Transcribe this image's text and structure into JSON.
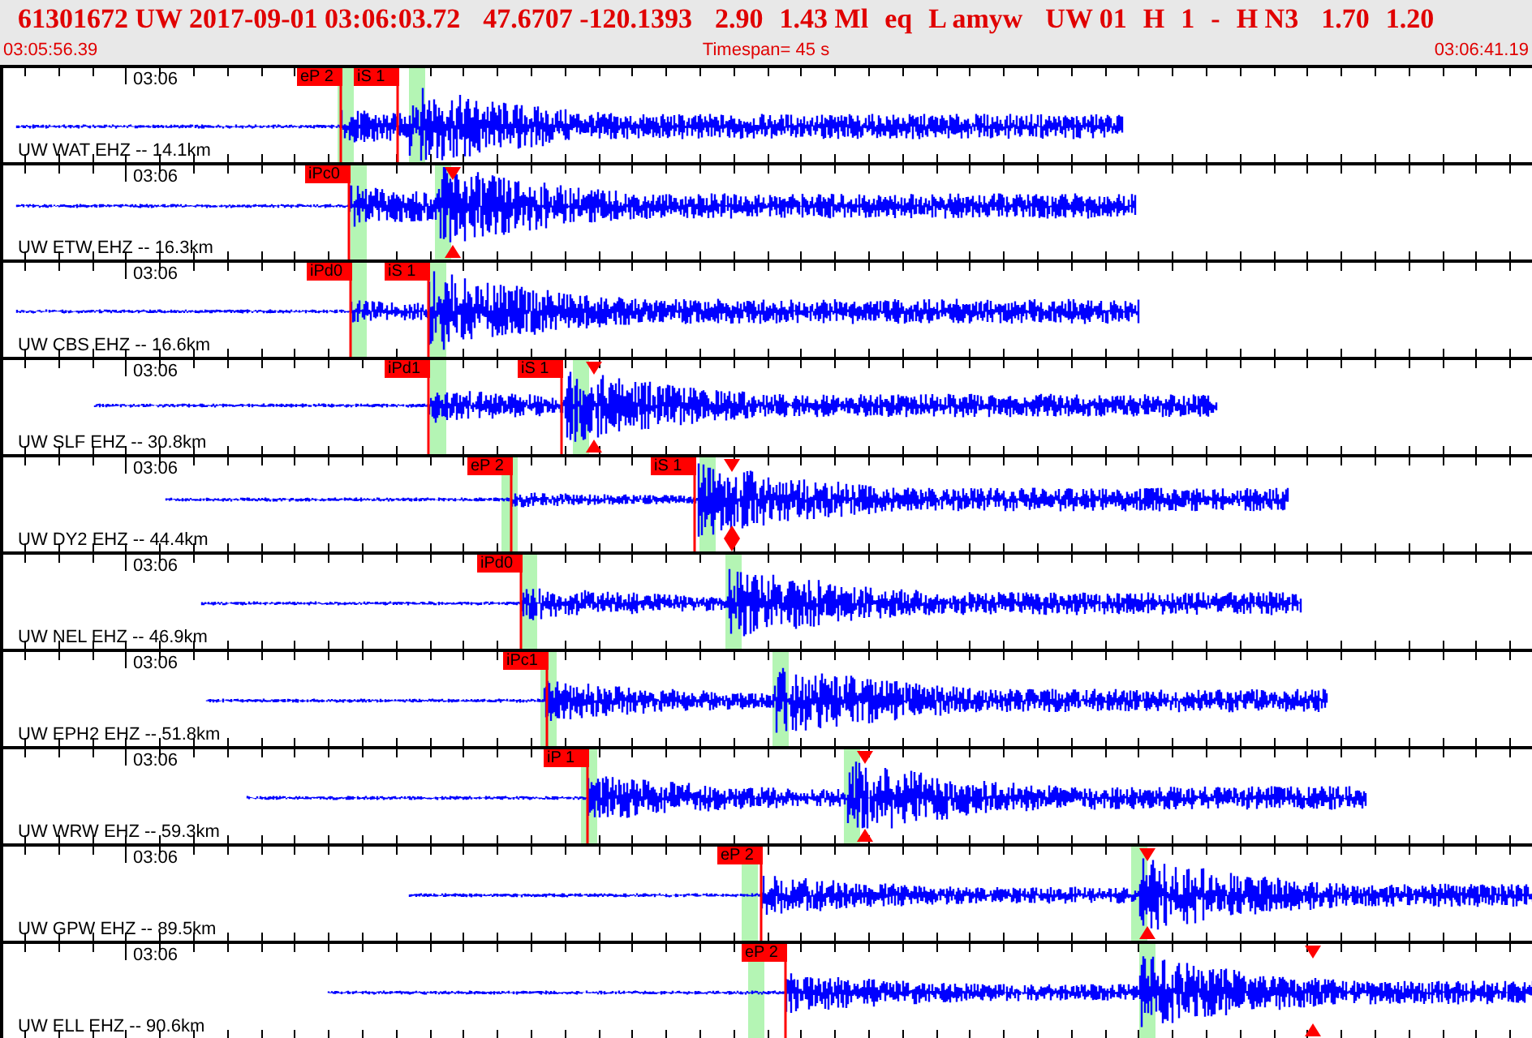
{
  "header": {
    "fields": [
      "61301672 UW 2017-09-01 03:06:03.72",
      "47.6707 -120.1393",
      "2.90",
      "1.43 Ml",
      "eq",
      "L amyw",
      "UW 01",
      "H",
      "1",
      "-",
      "H N3",
      "1.70",
      "1.20"
    ],
    "start_time": "03:05:56.39",
    "timespan": "Timespan=  45 s",
    "end_time": "03:06:41.19"
  },
  "traces": [
    {
      "station": "UW WAT EHZ -- 14.1km",
      "time_label": "03:06",
      "picks": [
        {
          "label": "eP 2"
        },
        {
          "label": "iS 1"
        }
      ]
    },
    {
      "station": "UW ETW EHZ -- 16.3km",
      "time_label": "03:06",
      "picks": [
        {
          "label": "iPc0"
        }
      ]
    },
    {
      "station": "UW CBS EHZ -- 16.6km",
      "time_label": "03:06",
      "picks": [
        {
          "label": "iPd0"
        },
        {
          "label": "iS 1"
        }
      ]
    },
    {
      "station": "UW SLF EHZ -- 30.8km",
      "time_label": "03:06",
      "picks": [
        {
          "label": "iPd1"
        },
        {
          "label": "iS 1"
        }
      ]
    },
    {
      "station": "UW DY2 EHZ -- 44.4km",
      "time_label": "03:06",
      "picks": [
        {
          "label": "eP 2"
        },
        {
          "label": "iS 1"
        }
      ]
    },
    {
      "station": "UW NEL EHZ -- 46.9km",
      "time_label": "03:06",
      "picks": [
        {
          "label": "iPd0"
        }
      ]
    },
    {
      "station": "UW EPH2 EHZ -- 51.8km",
      "time_label": "03:06",
      "picks": [
        {
          "label": "iPc1"
        }
      ]
    },
    {
      "station": "UW WRW EHZ -- 59.3km",
      "time_label": "03:06",
      "picks": [
        {
          "label": "iP 1"
        }
      ]
    },
    {
      "station": "UW GPW EHZ -- 89.5km",
      "time_label": "03:06",
      "picks": [
        {
          "label": "eP 2"
        }
      ]
    },
    {
      "station": "UW ELL EHZ -- 90.6km",
      "time_label": "03:06",
      "picks": [
        {
          "label": "eP 2"
        }
      ]
    }
  ]
}
